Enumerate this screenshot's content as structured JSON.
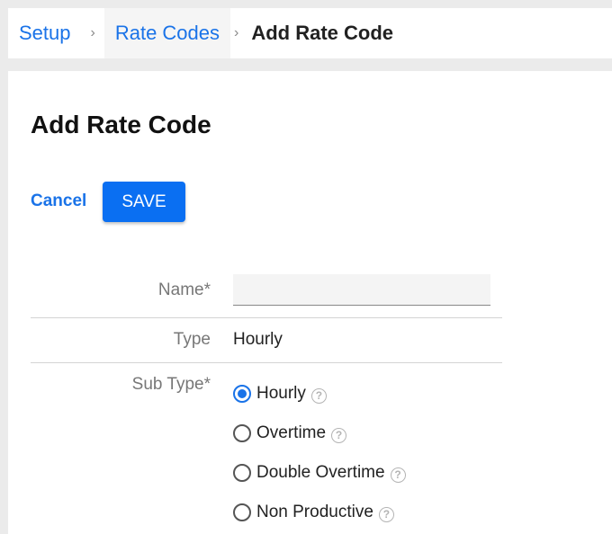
{
  "breadcrumb": {
    "items": [
      {
        "label": "Setup"
      },
      {
        "label": "Rate Codes"
      },
      {
        "label": "Add Rate Code"
      }
    ],
    "separator": "›"
  },
  "page": {
    "title": "Add Rate Code"
  },
  "actions": {
    "cancel_label": "Cancel",
    "save_label": "SAVE"
  },
  "form": {
    "name": {
      "label": "Name*",
      "value": "",
      "placeholder": ""
    },
    "type": {
      "label": "Type",
      "value": "Hourly"
    },
    "sub_type": {
      "label": "Sub Type*",
      "selected": "Hourly",
      "options": [
        {
          "label": "Hourly",
          "checked": true
        },
        {
          "label": "Overtime",
          "checked": false
        },
        {
          "label": "Double Overtime",
          "checked": false
        },
        {
          "label": "Non Productive",
          "checked": false
        }
      ],
      "help_glyph": "?"
    }
  },
  "colors": {
    "accent": "#1a73e8",
    "button": "#0a6ff2",
    "background": "#ebebeb"
  }
}
